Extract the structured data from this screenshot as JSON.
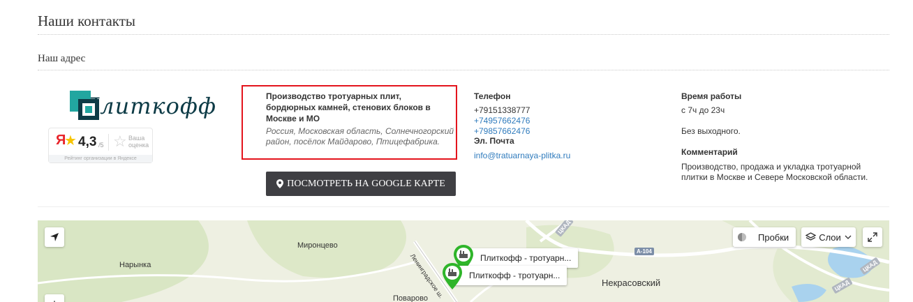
{
  "page": {
    "title": "Наши контакты",
    "section": "Наш адрес"
  },
  "logo": {
    "text": "Плиткофф"
  },
  "rating": {
    "ya": "Я",
    "score": "4,3",
    "outof": "/5",
    "rate_label": "Ваша оценка",
    "footer": "Рейтинг организации в Яндексе"
  },
  "address": {
    "title": "Производство тротуарных плит, бордюрных камней, стенових блоков в Москве и МО",
    "text": "Россия, Московская область, Солнечногорский район, посёлок Майдарово, Птицефабрика."
  },
  "map_button": {
    "label": "ПОСМОТРЕТЬ НА GOOGLE КАРТЕ"
  },
  "contacts": {
    "phone_label": "Телефон",
    "phones": [
      "+79151338777",
      "+74957662476",
      "+79857662476"
    ],
    "email_label": "Эл. Почта",
    "email": "info@tratuarnaya-plitka.ru"
  },
  "hours": {
    "label": "Время работы",
    "value": "с 7ч до 23ч",
    "days": "Без выходного.",
    "comment_label": "Комментарий",
    "comment": "Производство, продажа и укладка тротуарной плитки в Москве и Севере Московской области."
  },
  "map": {
    "places": {
      "mironcevo": "Миронцево",
      "narynka": "Нарынка",
      "nekrasovsky": "Некрасовский",
      "povarovo": "Поварово",
      "leningradskoe": "Ленинградское ш."
    },
    "roads": {
      "a104": "А-104",
      "ckad1": "ЦКАД",
      "ckad2": "ЦКАД",
      "ckad3": "ЦКАД"
    },
    "markers": [
      {
        "label": "Плиткофф - тротуарн..."
      },
      {
        "label": "Плиткофф - тротуарн..."
      }
    ],
    "controls": {
      "traffic": "Пробки",
      "layers": "Слои",
      "zoom_in": "+"
    }
  },
  "colors": {
    "accent_red": "#e4141c",
    "link": "#2f7bbd",
    "button": "#3f3f43",
    "marker": "#2fb52a"
  }
}
